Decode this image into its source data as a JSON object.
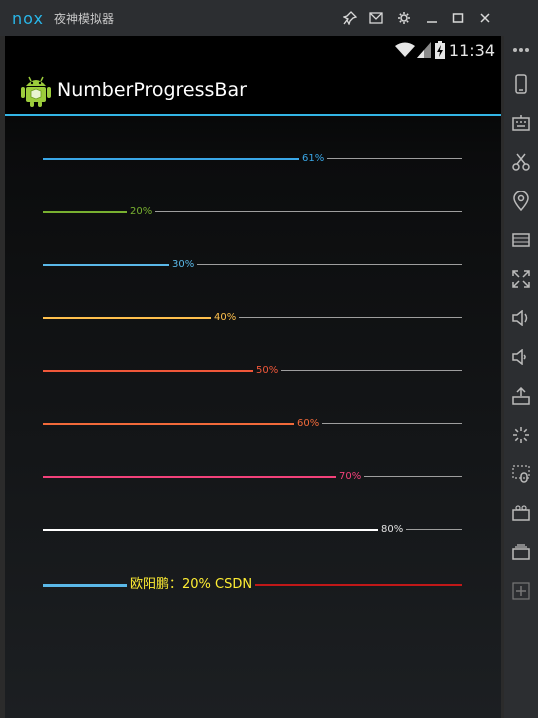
{
  "window": {
    "logo_text": "nox",
    "app_name": "夜神模拟器"
  },
  "status_bar": {
    "time": "11:34"
  },
  "action_bar": {
    "title": "NumberProgressBar"
  },
  "progress_bars": [
    {
      "label": "61%",
      "progress": 61,
      "reached_color": "#3aa8e8",
      "text_color": "#3aa8e8",
      "unreached_color": "#9e9e9e"
    },
    {
      "label": "20%",
      "progress": 20,
      "reached_color": "#78b030",
      "text_color": "#78b030",
      "unreached_color": "#9e9e9e"
    },
    {
      "label": "30%",
      "progress": 30,
      "reached_color": "#5ab8e8",
      "text_color": "#5ab8e8",
      "unreached_color": "#9e9e9e"
    },
    {
      "label": "40%",
      "progress": 40,
      "reached_color": "#ffc04d",
      "text_color": "#ffc04d",
      "unreached_color": "#9e9e9e"
    },
    {
      "label": "50%",
      "progress": 50,
      "reached_color": "#f0583a",
      "text_color": "#f0583a",
      "unreached_color": "#9e9e9e"
    },
    {
      "label": "60%",
      "progress": 60,
      "reached_color": "#f26a3a",
      "text_color": "#f26a3a",
      "unreached_color": "#9e9e9e"
    },
    {
      "label": "70%",
      "progress": 70,
      "reached_color": "#f2417a",
      "text_color": "#f2417a",
      "unreached_color": "#9e9e9e"
    },
    {
      "label": "80%",
      "progress": 80,
      "reached_color": "#ffffff",
      "text_color": "#e0e0e0",
      "unreached_color": "#9e9e9e"
    },
    {
      "label": "欧阳鹏：20%  CSDN",
      "progress": 20,
      "reached_color": "#5ab8e8",
      "text_color": "#ffee33",
      "unreached_color": "#c01818",
      "large": true
    }
  ],
  "colors": {
    "accent": "#33b5e5",
    "nox_brand": "#29b6e8"
  }
}
